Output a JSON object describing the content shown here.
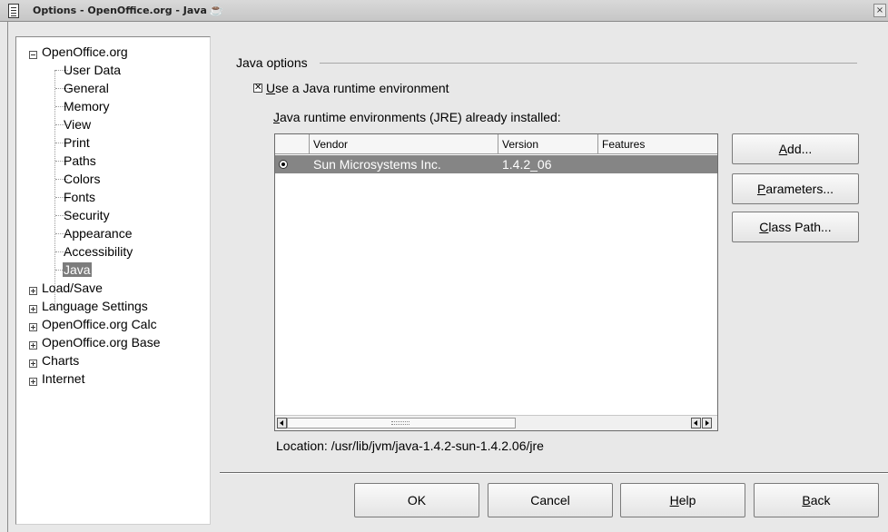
{
  "window": {
    "title": "Options - OpenOffice.org - Java",
    "close_glyph": "×"
  },
  "tree": {
    "root": {
      "label": "OpenOffice.org",
      "expanded": true,
      "children": [
        {
          "label": "User Data"
        },
        {
          "label": "General"
        },
        {
          "label": "Memory"
        },
        {
          "label": "View"
        },
        {
          "label": "Print"
        },
        {
          "label": "Paths"
        },
        {
          "label": "Colors"
        },
        {
          "label": "Fonts"
        },
        {
          "label": "Security"
        },
        {
          "label": "Appearance"
        },
        {
          "label": "Accessibility"
        },
        {
          "label": "Java",
          "selected": true
        }
      ]
    },
    "collapsed": [
      {
        "label": "Load/Save"
      },
      {
        "label": "Language Settings"
      },
      {
        "label": "OpenOffice.org Calc"
      },
      {
        "label": "OpenOffice.org Base"
      },
      {
        "label": "Charts"
      },
      {
        "label": "Internet"
      }
    ]
  },
  "java_options": {
    "group_title": "Java options",
    "use_jre": {
      "checked": true,
      "check_glyph": "✕",
      "accel": "U",
      "rest": "se a Java runtime environment"
    },
    "jre_label": {
      "accel": "J",
      "rest": "ava runtime environments (JRE) already installed:"
    },
    "table": {
      "columns": [
        "Vendor",
        "Version",
        "Features"
      ],
      "rows": [
        {
          "selected": true,
          "vendor": "Sun Microsystems Inc.",
          "version": "1.4.2_06",
          "features": ""
        }
      ]
    },
    "location": "Location: /usr/lib/jvm/java-1.4.2-sun-1.4.2.06/jre",
    "buttons": {
      "add": {
        "accel": "A",
        "rest": "dd..."
      },
      "parameters": {
        "accel": "P",
        "rest": "arameters..."
      },
      "classpath": {
        "accel": "C",
        "rest": "lass Path..."
      }
    }
  },
  "dialog_buttons": {
    "ok": "OK",
    "cancel": "Cancel",
    "help": {
      "accel": "H",
      "rest": "elp"
    },
    "back": {
      "accel": "B",
      "rest": "ack"
    }
  }
}
